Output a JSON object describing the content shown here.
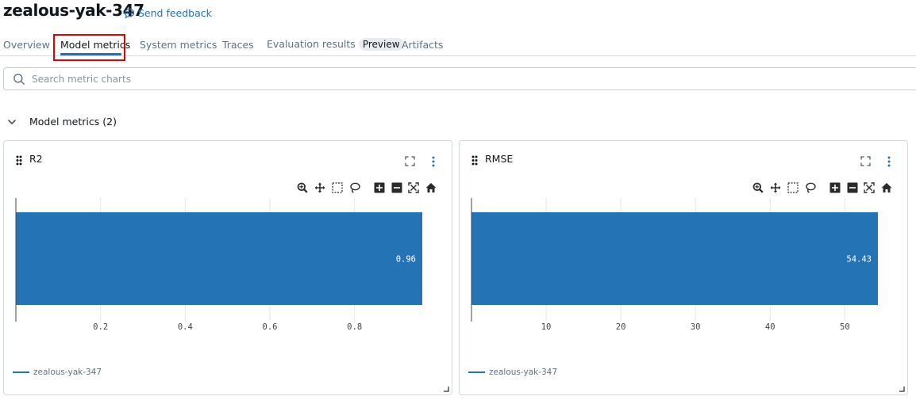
{
  "header": {
    "title": "zealous-yak-347",
    "feedback": "Send feedback"
  },
  "tabs": [
    {
      "label": "Overview"
    },
    {
      "label": "Model metrics"
    },
    {
      "label": "System metrics"
    },
    {
      "label": "Traces"
    },
    {
      "label": "Evaluation results",
      "badge": "Preview"
    },
    {
      "label": "Artifacts"
    }
  ],
  "active_tab": "Model metrics",
  "search": {
    "placeholder": "Search metric charts",
    "value": ""
  },
  "section": {
    "label": "Model metrics (2)"
  },
  "colors": {
    "accent": "#2272b4",
    "bar": "#2473b5",
    "highlight": "#e00000"
  },
  "charts": [
    {
      "title": "R2",
      "legend": "zealous-yak-347"
    },
    {
      "title": "RMSE",
      "legend": "zealous-yak-347"
    }
  ],
  "chart_data": [
    {
      "type": "bar",
      "orientation": "horizontal",
      "title": "R2",
      "series": [
        {
          "name": "zealous-yak-347",
          "values": [
            0.96
          ]
        }
      ],
      "value_labels": [
        "0.96"
      ],
      "xticks": [
        0.2,
        0.4,
        0.6,
        0.8
      ],
      "xtick_labels": [
        "0.2",
        "0.4",
        "0.6",
        "0.8"
      ],
      "xlim": [
        0,
        0.96
      ],
      "grid": true,
      "legend": "bottom-left",
      "color": "#2473b5"
    },
    {
      "type": "bar",
      "orientation": "horizontal",
      "title": "RMSE",
      "series": [
        {
          "name": "zealous-yak-347",
          "values": [
            54.43
          ]
        }
      ],
      "value_labels": [
        "54.43"
      ],
      "xticks": [
        10,
        20,
        30,
        40,
        50
      ],
      "xtick_labels": [
        "10",
        "20",
        "30",
        "40",
        "50"
      ],
      "xlim": [
        0,
        54.43
      ],
      "grid": true,
      "legend": "bottom-left",
      "color": "#2473b5"
    }
  ]
}
